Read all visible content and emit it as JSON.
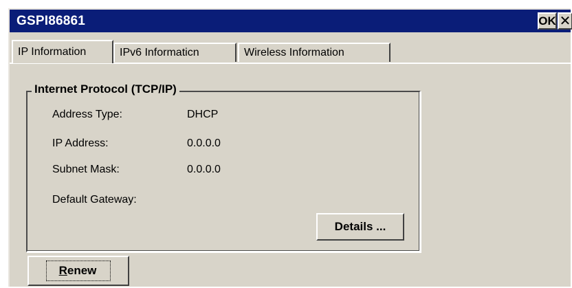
{
  "window": {
    "title": "GSPI86861",
    "ok_label": "OK",
    "close_label": "✕"
  },
  "tabs": [
    {
      "label": "IP Information",
      "active": true
    },
    {
      "label": "IPv6 Informaticn",
      "active": false
    },
    {
      "label": "Wireless Information",
      "active": false
    }
  ],
  "group": {
    "legend": "Internet Protocol (TCP/IP)",
    "fields": [
      {
        "label": "Address Type:",
        "value": "DHCP"
      },
      {
        "label": "IP Address:",
        "value": "0.0.0.0"
      },
      {
        "label": "Subnet Mask:",
        "value": "0.0.0.0"
      },
      {
        "label": "Default Gateway:",
        "value": ""
      }
    ],
    "details_label": "Details ..."
  },
  "renew": {
    "first_letter": "R",
    "rest": "enew"
  },
  "colors": {
    "titlebar": "#0a1d78",
    "face": "#d8d4c9"
  }
}
